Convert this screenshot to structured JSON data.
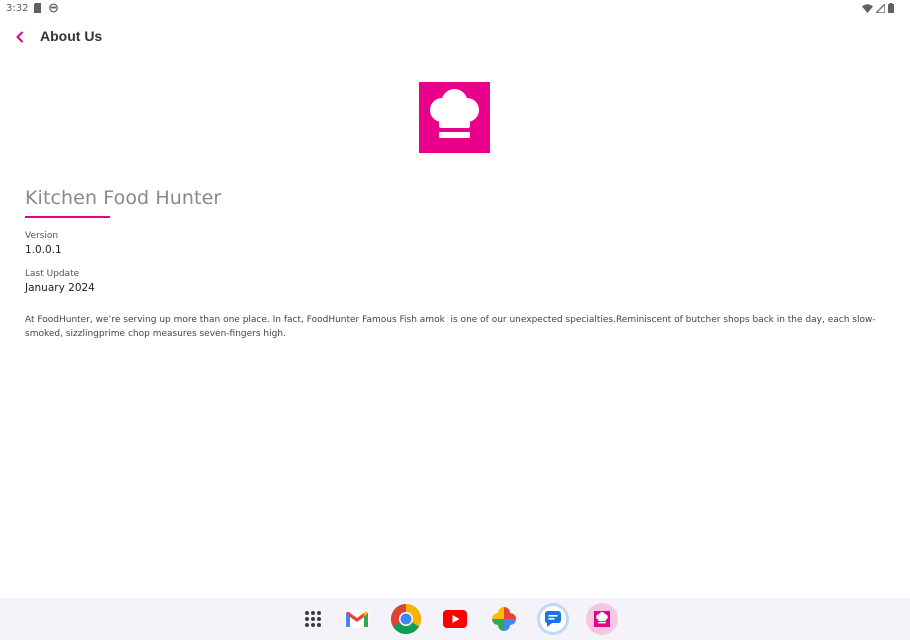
{
  "status_bar": {
    "time": "3:32"
  },
  "app_bar": {
    "title": "About Us"
  },
  "about": {
    "app_name": "Kitchen Food Hunter",
    "version_label": "Version",
    "version_value": "1.0.0.1",
    "update_label": "Last Update",
    "update_value": "January 2024",
    "description": "At FoodHunter, we’re serving up more than one place. In fact, FoodHunter Famous Fish amok  is one of our unexpected specialties.Reminiscent of butcher shops back in the day, each slow-smoked, sizzlingprime chop measures seven-fingers high."
  },
  "taskbar": {
    "apps": [
      "app-drawer-icon",
      "gmail-icon",
      "chrome-icon",
      "youtube-icon",
      "photos-icon",
      "messages-icon",
      "kitchen-food-hunter-icon"
    ]
  },
  "colors": {
    "accent": "#E8008A",
    "underline": "#E8008A",
    "taskbar": "#f4f3fa"
  }
}
